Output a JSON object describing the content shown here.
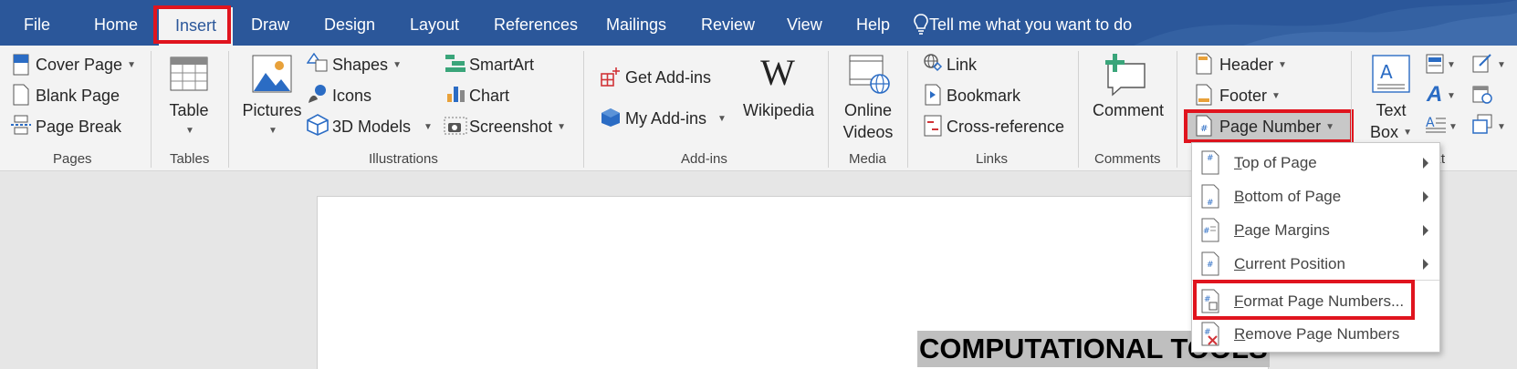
{
  "tabs": [
    "File",
    "Home",
    "Insert",
    "Draw",
    "Design",
    "Layout",
    "References",
    "Mailings",
    "Review",
    "View",
    "Help"
  ],
  "active_tab": "Insert",
  "tell_me": "Tell me what you want to do",
  "ribbon": {
    "pages": {
      "cover_page": "Cover Page",
      "blank_page": "Blank Page",
      "page_break": "Page Break",
      "label": "Pages"
    },
    "tables": {
      "table": "Table",
      "label": "Tables"
    },
    "illustrations": {
      "pictures": "Pictures",
      "shapes": "Shapes",
      "icons": "Icons",
      "models_3d": "3D Models",
      "smartart": "SmartArt",
      "chart": "Chart",
      "screenshot": "Screenshot",
      "label": "Illustrations"
    },
    "addins": {
      "get_addins": "Get Add-ins",
      "my_addins": "My Add-ins",
      "wikipedia": "Wikipedia",
      "label": "Add-ins"
    },
    "media": {
      "online": "Online",
      "videos": "Videos",
      "label": "Media"
    },
    "links": {
      "link": "Link",
      "bookmark": "Bookmark",
      "cross_reference": "Cross-reference",
      "label": "Links"
    },
    "comments": {
      "comment": "Comment",
      "label": "Comments"
    },
    "header_footer": {
      "header": "Header",
      "footer": "Footer",
      "page_number": "Page Number"
    },
    "text": {
      "text": "Text",
      "box": "Box",
      "label_partial": "ext"
    }
  },
  "page_number_menu": {
    "items": [
      {
        "ul": "T",
        "rest": "op of Page",
        "submenu": true
      },
      {
        "ul": "B",
        "rest": "ottom of Page",
        "submenu": true
      },
      {
        "ul": "P",
        "rest": "age Margins",
        "submenu": true
      },
      {
        "ul": "C",
        "rest": "urrent Position",
        "submenu": true
      },
      {
        "ul": "F",
        "rest": "ormat Page Numbers...",
        "submenu": false
      },
      {
        "ul": "R",
        "rest": "emove Page Numbers",
        "submenu": false
      }
    ]
  },
  "document": {
    "heading": "COMPUTATIONAL TOOLS"
  },
  "colors": {
    "tab_bar": "#2b579a",
    "highlight": "#e0141e",
    "ribbon": "#f3f3f3"
  }
}
